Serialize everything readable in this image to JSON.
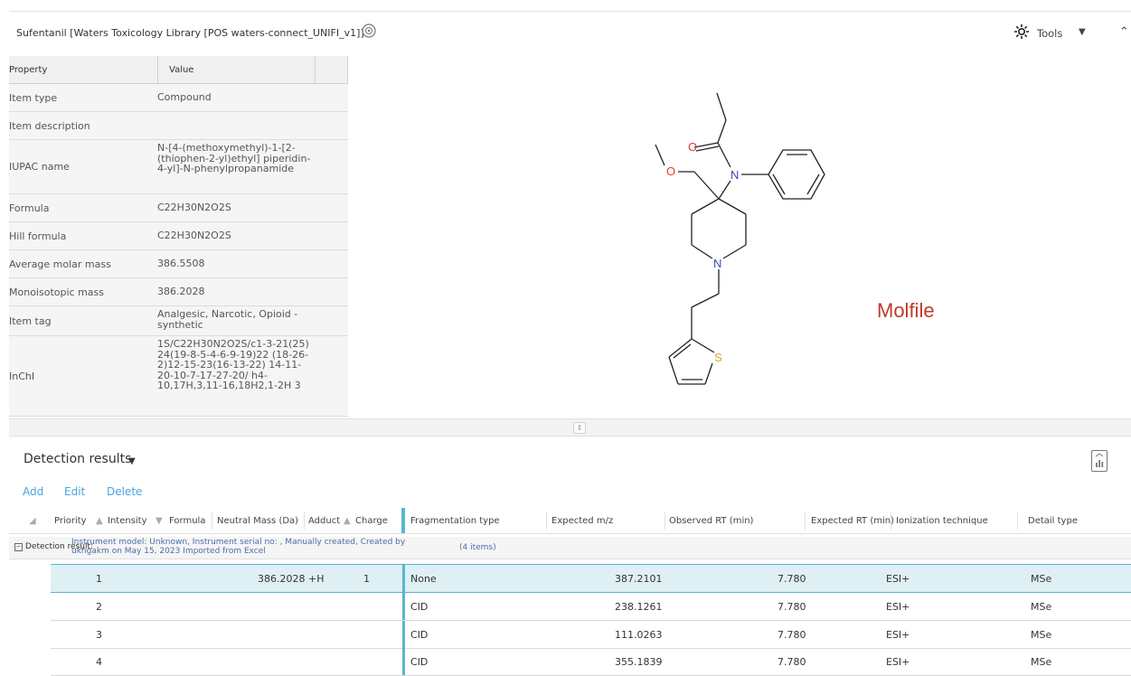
{
  "header": {
    "title": "Sufentanil  [Waters Toxicology Library [POS waters-connect_UNIFI_v1]]",
    "tools_label": "Tools"
  },
  "properties": {
    "columns": {
      "property": "Property",
      "value": "Value"
    },
    "rows": [
      {
        "key": "Item type",
        "value": "Compound"
      },
      {
        "key": "Item description",
        "value": ""
      },
      {
        "key": "IUPAC name",
        "value": "N-[4-(methoxymethyl)-1-[2-(thiophen-2-yl)ethyl] piperidin-4-yl]-N-phenylpropanamide"
      },
      {
        "key": "Formula",
        "value": "C22H30N2O2S"
      },
      {
        "key": "Hill formula",
        "value": "C22H30N2O2S"
      },
      {
        "key": "Average molar mass",
        "value": "386.5508"
      },
      {
        "key": "Monoisotopic mass",
        "value": "386.2028"
      },
      {
        "key": "Item tag",
        "value": "Analgesic, Narcotic, Opioid - synthetic"
      },
      {
        "key": "InChI",
        "value": "1S/C22H30N2O2S/c1-3-21(25) 24(19-8-5-4-6-9-19)22 (18-26-2)12-15-23(16-13-22) 14-11-20-10-7-17-27-20/ h4-10,17H,3,11-16,18H2,1-2H 3"
      }
    ]
  },
  "structure": {
    "atoms": {
      "o1": "O",
      "o2": "O",
      "n1": "N",
      "n2": "N",
      "s": "S"
    },
    "annotation": "Molfile",
    "colors": {
      "oxygen": "#e03a2f",
      "nitrogen": "#3a48b5",
      "sulfur": "#e0a22f",
      "annotation": "#c0392b"
    }
  },
  "detection": {
    "title": "Detection results",
    "actions": {
      "add": "Add",
      "edit": "Edit",
      "delete": "Delete"
    },
    "columns": {
      "priority": "Priority",
      "intensity": "Intensity",
      "formula": "Formula",
      "neutral_mass": "Neutral Mass (Da)",
      "adduct": "Adduct",
      "charge": "Charge",
      "fragmentation": "Fragmentation type",
      "expected_mz": "Expected m/z",
      "observed_rt": "Observed RT (min)",
      "expected_rt": "Expected RT (min)",
      "ionization": "Ionization technique",
      "detail_type": "Detail type"
    },
    "group": {
      "label": "Detection result:",
      "text": "Instrument model: Unknown, Instrument serial no: , Manually created, Created by ukngakm on May 15, 2023 Imported from Excel",
      "count": "(4 items)"
    },
    "rows": [
      {
        "priority": "1",
        "neutral_mass": "386.2028",
        "adduct": "+H",
        "charge": "1",
        "fragmentation": "None",
        "expected_mz": "387.2101",
        "observed_rt": "7.780",
        "ionization": "ESI+",
        "detail_type": "MSe",
        "selected": true
      },
      {
        "priority": "2",
        "neutral_mass": "",
        "adduct": "",
        "charge": "",
        "fragmentation": "CID",
        "expected_mz": "238.1261",
        "observed_rt": "7.780",
        "ionization": "ESI+",
        "detail_type": "MSe",
        "selected": false
      },
      {
        "priority": "3",
        "neutral_mass": "",
        "adduct": "",
        "charge": "",
        "fragmentation": "CID",
        "expected_mz": "111.0263",
        "observed_rt": "7.780",
        "ionization": "ESI+",
        "detail_type": "MSe",
        "selected": false
      },
      {
        "priority": "4",
        "neutral_mass": "",
        "adduct": "",
        "charge": "",
        "fragmentation": "CID",
        "expected_mz": "355.1839",
        "observed_rt": "7.780",
        "ionization": "ESI+",
        "detail_type": "MSe",
        "selected": false
      }
    ]
  }
}
